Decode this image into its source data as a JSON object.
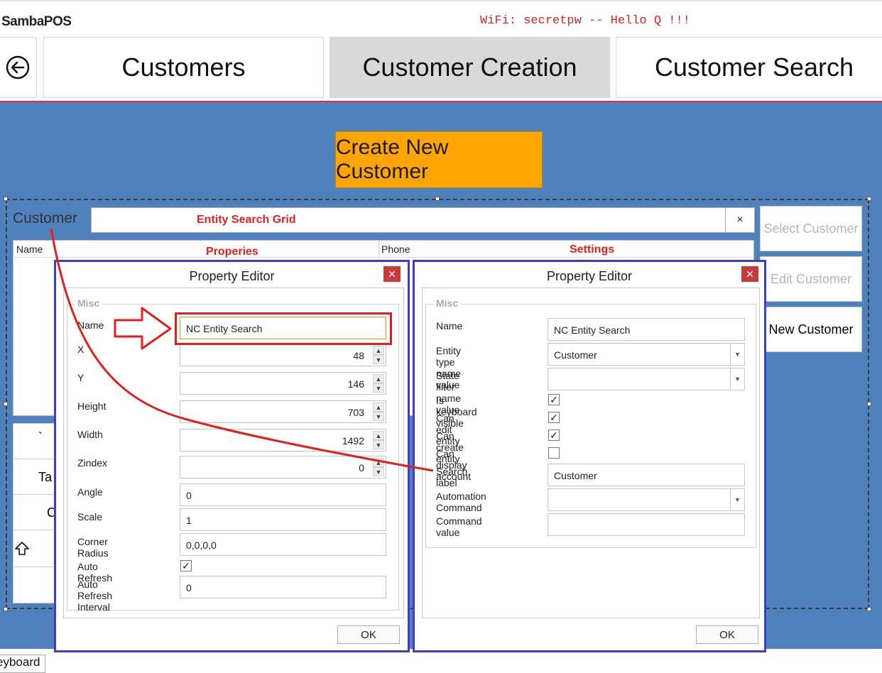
{
  "brand": "SambaPOS",
  "banner": "WiFi: secretpw -- Hello Q !!!",
  "nav": {
    "tabs": [
      {
        "label": "Customers"
      },
      {
        "label": "Customer Creation"
      },
      {
        "label": "Customer Search"
      }
    ]
  },
  "main": {
    "create_button": "Create New Customer",
    "search_label": "Customer",
    "clear_button": "×",
    "grid": {
      "columns": [
        "Name",
        "Phone"
      ]
    },
    "side_buttons": [
      {
        "label": "Select Customer",
        "enabled": false
      },
      {
        "label": "Edit Customer",
        "enabled": false
      },
      {
        "label": "New Customer",
        "enabled": true
      }
    ],
    "keypad": [
      "`",
      "Ta",
      "C"
    ]
  },
  "keyboard_tab": "eyboard",
  "annotations": {
    "entity_search_grid": "Entity Search Grid",
    "properies": "Properies",
    "settings": "Settings"
  },
  "dialog_left": {
    "title": "Property Editor",
    "close": "✕",
    "group": "Misc",
    "props": {
      "name_label": "Name",
      "name_value": "NC Entity Search",
      "x_label": "X",
      "x_value": "48",
      "y_label": "Y",
      "y_value": "146",
      "height_label": "Height",
      "height_value": "703",
      "width_label": "Width",
      "width_value": "1492",
      "zindex_label": "Zindex",
      "zindex_value": "0",
      "angle_label": "Angle",
      "angle_value": "0",
      "scale_label": "Scale",
      "scale_value": "1",
      "corner_label": "Corner Radius",
      "corner_value": "0,0,0,0",
      "autorefresh_label": "Auto Refresh",
      "autorefresh_checked": true,
      "interval_label": "Auto Refresh Interval",
      "interval_value": "0"
    },
    "ok": "OK"
  },
  "dialog_right": {
    "title": "Property Editor",
    "close": "✕",
    "group": "Misc",
    "props": {
      "name_label": "Name",
      "name_value": "NC Entity Search",
      "entity_type_label": "Entity type name value",
      "entity_type_value": "Customer",
      "state_filter_label": "State filter name value",
      "state_filter_value": "",
      "keyboard_label": "Is keyboard visible",
      "keyboard_checked": true,
      "can_edit_label": "Can edit entity",
      "can_edit_checked": true,
      "can_create_label": "Can create entity",
      "can_create_checked": true,
      "can_display_label": "Can display account",
      "can_display_checked": false,
      "search_label_label": "Search label",
      "search_label_value": "Customer",
      "automation_label": "Automation Command",
      "automation_value": "",
      "command_value_label": "Command value",
      "command_value_value": ""
    },
    "ok": "OK"
  },
  "colors": {
    "background_blue": "#4f81bd",
    "create_orange": "#ffa500",
    "annotation_red": "#e0201c",
    "dialog_border": "#3d3dc8",
    "close_red": "#c93a3a"
  }
}
